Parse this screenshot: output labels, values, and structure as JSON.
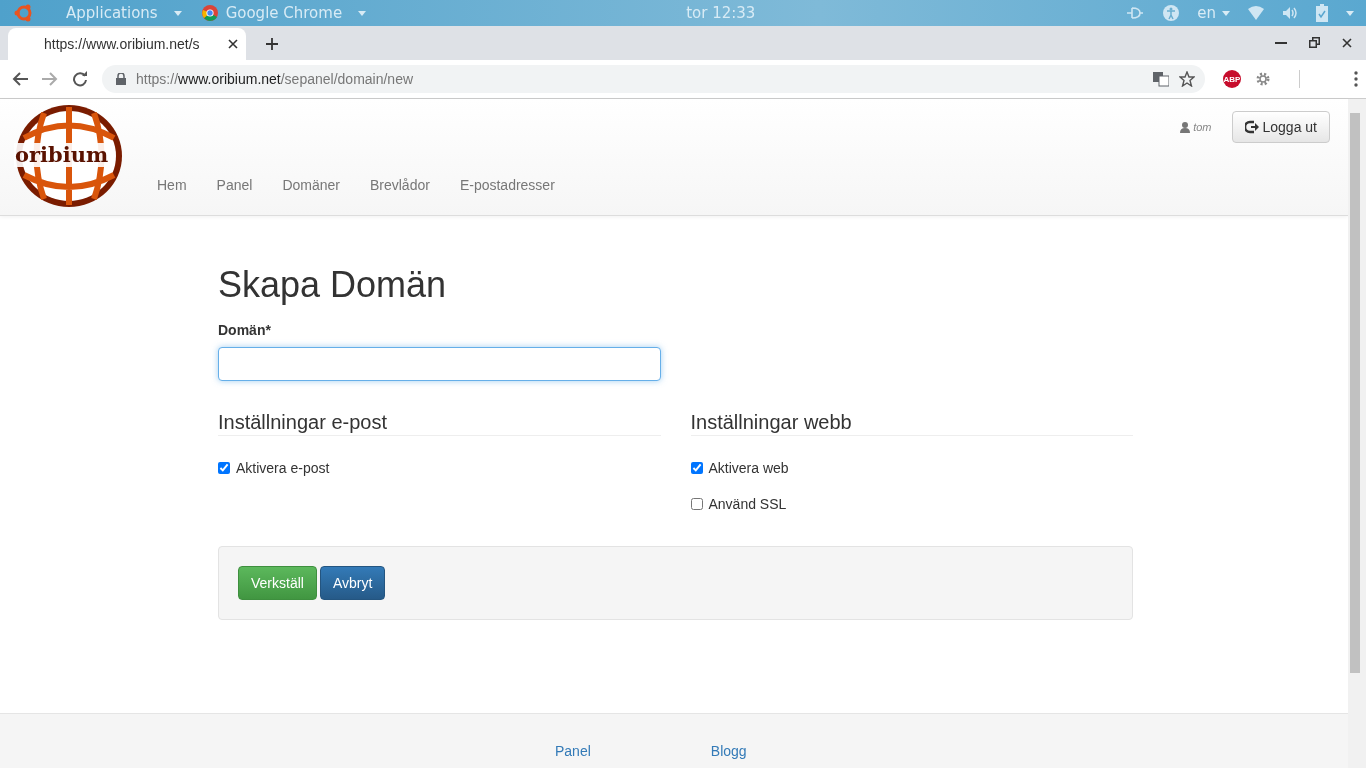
{
  "desktop_bar": {
    "applications": "Applications",
    "app": "Google Chrome",
    "clock": "tor 12:33",
    "language": "en"
  },
  "browser": {
    "tab_title": "https://www.oribium.net/s",
    "url": {
      "scheme": "https://",
      "host": "www.oribium.net",
      "path": "/sepanel/domain/new"
    },
    "extension": "ABP"
  },
  "site": {
    "logo_text": "oribium",
    "nav": [
      {
        "label": "Hem"
      },
      {
        "label": "Panel"
      },
      {
        "label": "Domäner"
      },
      {
        "label": "Brevlådor"
      },
      {
        "label": "E-postadresser"
      }
    ],
    "user": "tom",
    "logout": "Logga ut"
  },
  "form": {
    "title": "Skapa Domän",
    "domain_label": "Domän*",
    "sections": [
      {
        "title": "Inställningar e-post",
        "options": [
          {
            "label": "Aktivera e-post",
            "checked": true
          }
        ]
      },
      {
        "title": "Inställningar webb",
        "options": [
          {
            "label": "Aktivera web",
            "checked": true
          },
          {
            "label": "Använd SSL",
            "checked": false
          }
        ]
      }
    ],
    "buttons": [
      {
        "label": "Verkställ",
        "kind": "success"
      },
      {
        "label": "Avbryt",
        "kind": "primary"
      }
    ]
  },
  "footer": {
    "links": [
      "Panel",
      "Blogg"
    ]
  }
}
